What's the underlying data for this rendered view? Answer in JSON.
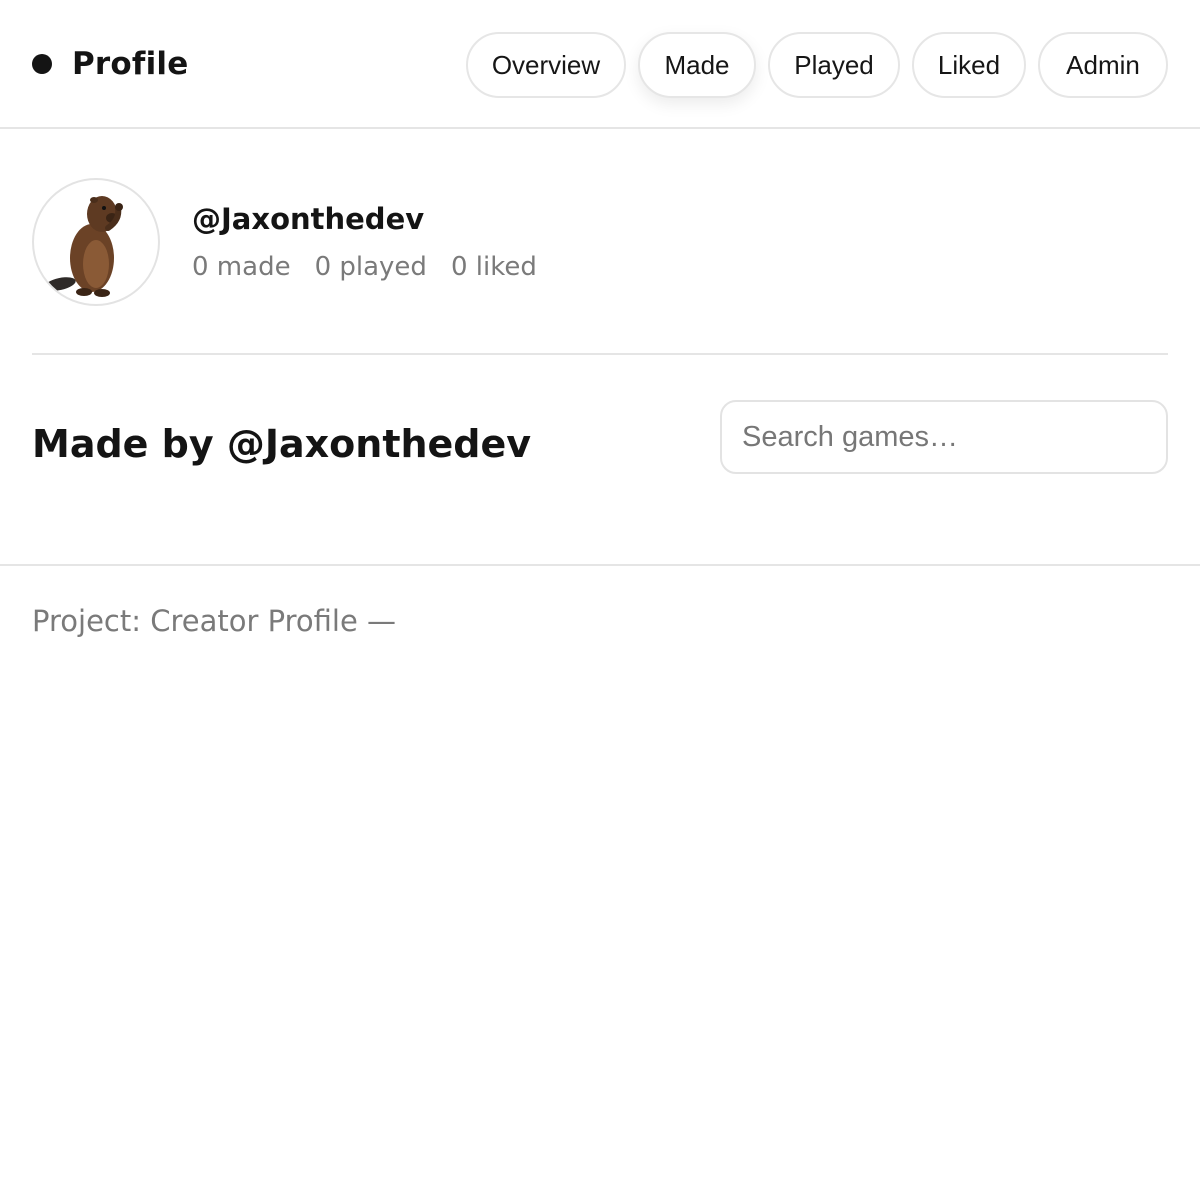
{
  "header": {
    "title": "Profile",
    "tabs": [
      {
        "label": "Overview"
      },
      {
        "label": "Made"
      },
      {
        "label": "Played"
      },
      {
        "label": "Liked"
      },
      {
        "label": "Admin"
      }
    ],
    "active_tab": "Made"
  },
  "profile": {
    "avatar_icon": "beaver-avatar",
    "handle": "@Jaxonthedev",
    "stats": {
      "made": "0 made",
      "played": "0 played",
      "liked": "0 liked"
    }
  },
  "section": {
    "title": "Made by @Jaxonthedev",
    "search_placeholder": "Search games…"
  },
  "footer": {
    "text": "Project: Creator Profile —"
  },
  "colors": {
    "text": "#141414",
    "muted": "#7a7a7a",
    "border": "#e5e5e5",
    "background": "#ffffff"
  }
}
